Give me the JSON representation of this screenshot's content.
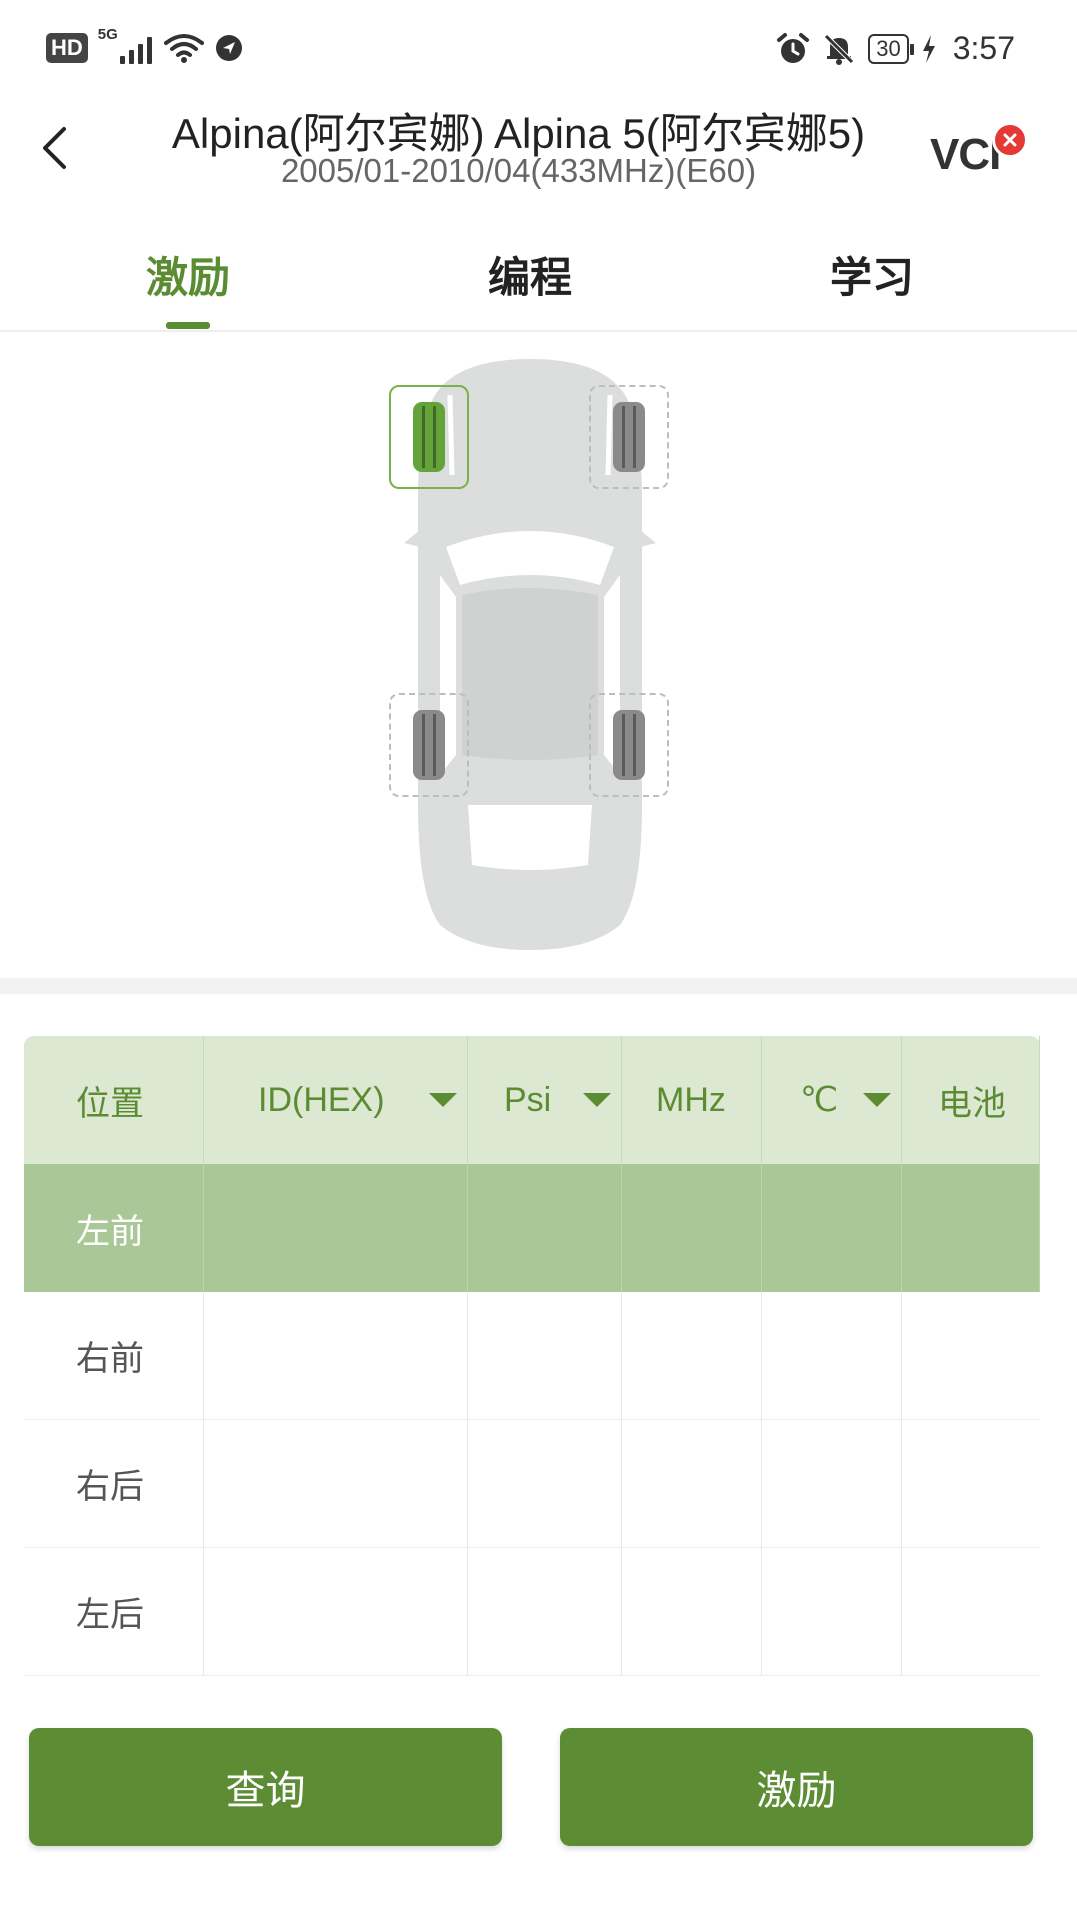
{
  "status_bar": {
    "hd_label": "HD",
    "network_label": "5G",
    "battery_level": "30",
    "time": "3:57"
  },
  "header": {
    "title": "Alpina(阿尔宾娜) Alpina 5(阿尔宾娜5)",
    "subtitle": "2005/01-2010/04(433MHz)(E60)",
    "vci_label": "VCI",
    "vci_status": "disconnected"
  },
  "tabs": [
    {
      "label": "激励",
      "active": true
    },
    {
      "label": "编程",
      "active": false
    },
    {
      "label": "学习",
      "active": false
    }
  ],
  "car_diagram": {
    "wheels": [
      {
        "position": "left-front",
        "selected": true
      },
      {
        "position": "right-front",
        "selected": false
      },
      {
        "position": "left-rear",
        "selected": false
      },
      {
        "position": "right-rear",
        "selected": false
      }
    ]
  },
  "table": {
    "columns": [
      "位置",
      "ID(HEX)",
      "Psi",
      "MHz",
      "℃",
      "电池"
    ],
    "rows": [
      {
        "position": "左前",
        "selected": true
      },
      {
        "position": "右前",
        "selected": false
      },
      {
        "position": "右后",
        "selected": false
      },
      {
        "position": "左后",
        "selected": false
      }
    ]
  },
  "buttons": {
    "query_label": "查询",
    "activate_label": "激励"
  },
  "colors": {
    "accent": "#5b8c32",
    "header_row_bg": "#dce8d2",
    "selected_row_bg": "#aac797",
    "button_bg": "#5c8c33",
    "vci_error": "#e53935"
  }
}
